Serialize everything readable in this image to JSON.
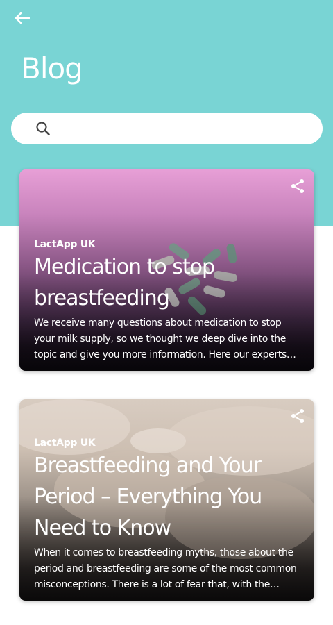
{
  "header": {
    "title": "Blog",
    "back_icon": "arrow-left-icon",
    "background_color": "#79d4d4"
  },
  "search": {
    "value": "",
    "placeholder": "",
    "icon": "search-icon"
  },
  "posts": [
    {
      "source": "LactApp UK",
      "title": "Medication to stop breastfeeding",
      "excerpt": "We receive many questions about medication to stop your milk supply, so we thought we deep dive into the topic and give you more information. Here our experts a...",
      "share_icon": "share-icon"
    },
    {
      "source": "LactApp UK",
      "title": "Breastfeeding and Your Period – Everything You Need to Know",
      "excerpt": "When it comes to breastfeeding myths, those about the period and breastfeeding are some of the most common misconceptions. There is a lot of fear that, with the reap...",
      "share_icon": "share-icon"
    }
  ]
}
